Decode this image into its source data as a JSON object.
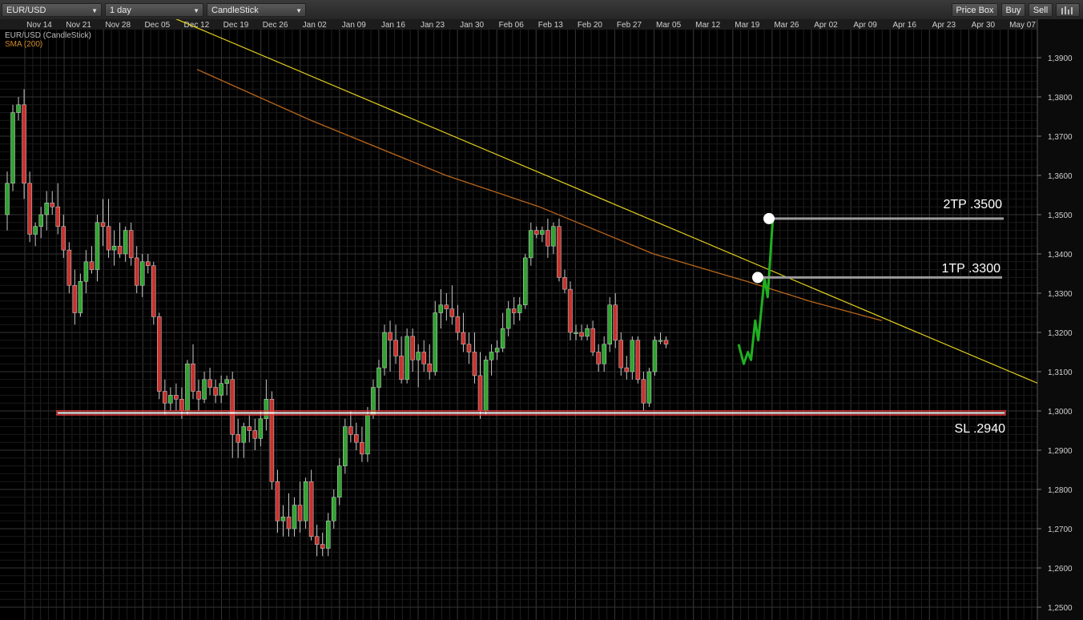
{
  "toolbar": {
    "symbol": "EUR/USD",
    "period": "1 day",
    "chart_type": "CandleStick",
    "price_box": "Price Box",
    "buy": "Buy",
    "sell": "Sell",
    "indicator_icon": "bar-chart-icon"
  },
  "legend": {
    "series1": "EUR/USD (CandleStick)",
    "series2": "SMA (200)"
  },
  "colors": {
    "up": "#2fa52f",
    "down": "#c8322d",
    "trendline": "#e6d21e",
    "sma": "#b8661a",
    "support": "#e23a3a",
    "projection": "#20b020"
  },
  "annotations": {
    "tp2": "2TP .3500",
    "tp1": "1TP .3300",
    "sl": "SL .2940"
  },
  "chart_data": {
    "type": "candlestick",
    "x_ticks": [
      "Nov 14",
      "Nov 21",
      "Nov 28",
      "Dec 05",
      "Dec 12",
      "Dec 19",
      "Dec 26",
      "Jan 02",
      "Jan 09",
      "Jan 16",
      "Jan 23",
      "Jan 30",
      "Feb 06",
      "Feb 13",
      "Feb 20",
      "Feb 27",
      "Mar 05",
      "Mar 12",
      "Mar 19",
      "Mar 26",
      "Apr 02",
      "Apr 09",
      "Apr 16",
      "Apr 23",
      "Apr 30",
      "May 07"
    ],
    "y_ticks": [
      "1,3900",
      "1,3800",
      "1,3700",
      "1,3600",
      "1,3500",
      "1,3400",
      "1,3300",
      "1,3200",
      "1,3100",
      "1,3000",
      "1,2900",
      "1,2800",
      "1,2700",
      "1,2600",
      "1,2500"
    ],
    "ylim": [
      1.247,
      1.4
    ],
    "candles": [
      [
        1.35,
        1.361,
        1.346,
        1.358
      ],
      [
        1.358,
        1.378,
        1.356,
        1.376
      ],
      [
        1.376,
        1.38,
        1.374,
        1.378
      ],
      [
        1.378,
        1.382,
        1.354,
        1.358
      ],
      [
        1.358,
        1.361,
        1.343,
        1.345
      ],
      [
        1.345,
        1.348,
        1.342,
        1.347
      ],
      [
        1.347,
        1.352,
        1.344,
        1.35
      ],
      [
        1.35,
        1.356,
        1.346,
        1.353
      ],
      [
        1.353,
        1.356,
        1.35,
        1.352
      ],
      [
        1.352,
        1.358,
        1.345,
        1.347
      ],
      [
        1.347,
        1.35,
        1.339,
        1.341
      ],
      [
        1.341,
        1.343,
        1.33,
        1.332
      ],
      [
        1.332,
        1.336,
        1.322,
        1.325
      ],
      [
        1.325,
        1.335,
        1.324,
        1.333
      ],
      [
        1.333,
        1.341,
        1.33,
        1.338
      ],
      [
        1.338,
        1.342,
        1.335,
        1.336
      ],
      [
        1.336,
        1.35,
        1.333,
        1.348
      ],
      [
        1.348,
        1.354,
        1.342,
        1.347
      ],
      [
        1.347,
        1.354,
        1.339,
        1.341
      ],
      [
        1.341,
        1.346,
        1.337,
        1.342
      ],
      [
        1.342,
        1.348,
        1.339,
        1.34
      ],
      [
        1.34,
        1.347,
        1.338,
        1.346
      ],
      [
        1.346,
        1.348,
        1.337,
        1.339
      ],
      [
        1.339,
        1.342,
        1.33,
        1.332
      ],
      [
        1.332,
        1.34,
        1.329,
        1.338
      ],
      [
        1.338,
        1.34,
        1.335,
        1.337
      ],
      [
        1.337,
        1.338,
        1.322,
        1.324
      ],
      [
        1.324,
        1.325,
        1.303,
        1.305
      ],
      [
        1.305,
        1.308,
        1.299,
        1.302
      ],
      [
        1.302,
        1.306,
        1.3,
        1.304
      ],
      [
        1.304,
        1.307,
        1.3,
        1.303
      ],
      [
        1.303,
        1.306,
        1.298,
        1.3
      ],
      [
        1.3,
        1.313,
        1.299,
        1.312
      ],
      [
        1.312,
        1.317,
        1.303,
        1.305
      ],
      [
        1.305,
        1.308,
        1.3,
        1.303
      ],
      [
        1.303,
        1.31,
        1.302,
        1.308
      ],
      [
        1.308,
        1.311,
        1.304,
        1.306
      ],
      [
        1.306,
        1.308,
        1.302,
        1.304
      ],
      [
        1.304,
        1.309,
        1.302,
        1.307
      ],
      [
        1.307,
        1.309,
        1.304,
        1.308
      ],
      [
        1.308,
        1.31,
        1.288,
        1.294
      ],
      [
        1.294,
        1.298,
        1.288,
        1.292
      ],
      [
        1.292,
        1.297,
        1.288,
        1.296
      ],
      [
        1.296,
        1.299,
        1.292,
        1.295
      ],
      [
        1.295,
        1.298,
        1.29,
        1.293
      ],
      [
        1.293,
        1.3,
        1.291,
        1.298
      ],
      [
        1.298,
        1.308,
        1.295,
        1.303
      ],
      [
        1.303,
        1.305,
        1.28,
        1.282
      ],
      [
        1.282,
        1.285,
        1.269,
        1.272
      ],
      [
        1.272,
        1.276,
        1.268,
        1.273
      ],
      [
        1.273,
        1.279,
        1.268,
        1.27
      ],
      [
        1.27,
        1.278,
        1.268,
        1.276
      ],
      [
        1.276,
        1.282,
        1.269,
        1.272
      ],
      [
        1.272,
        1.283,
        1.27,
        1.282
      ],
      [
        1.282,
        1.285,
        1.267,
        1.268
      ],
      [
        1.268,
        1.271,
        1.263,
        1.266
      ],
      [
        1.266,
        1.269,
        1.263,
        1.265
      ],
      [
        1.265,
        1.274,
        1.263,
        1.272
      ],
      [
        1.272,
        1.28,
        1.27,
        1.278
      ],
      [
        1.278,
        1.288,
        1.276,
        1.286
      ],
      [
        1.286,
        1.298,
        1.284,
        1.296
      ],
      [
        1.296,
        1.3,
        1.292,
        1.294
      ],
      [
        1.294,
        1.297,
        1.29,
        1.292
      ],
      [
        1.292,
        1.296,
        1.287,
        1.289
      ],
      [
        1.289,
        1.301,
        1.287,
        1.299
      ],
      [
        1.299,
        1.308,
        1.298,
        1.306
      ],
      [
        1.306,
        1.313,
        1.3,
        1.311
      ],
      [
        1.311,
        1.322,
        1.309,
        1.32
      ],
      [
        1.32,
        1.323,
        1.31,
        1.318
      ],
      [
        1.318,
        1.322,
        1.312,
        1.314
      ],
      [
        1.314,
        1.319,
        1.307,
        1.308
      ],
      [
        1.308,
        1.321,
        1.307,
        1.319
      ],
      [
        1.319,
        1.321,
        1.31,
        1.313
      ],
      [
        1.313,
        1.317,
        1.306,
        1.315
      ],
      [
        1.315,
        1.318,
        1.31,
        1.312
      ],
      [
        1.312,
        1.317,
        1.308,
        1.31
      ],
      [
        1.31,
        1.328,
        1.309,
        1.325
      ],
      [
        1.325,
        1.331,
        1.321,
        1.327
      ],
      [
        1.327,
        1.33,
        1.323,
        1.326
      ],
      [
        1.326,
        1.332,
        1.322,
        1.324
      ],
      [
        1.324,
        1.327,
        1.318,
        1.32
      ],
      [
        1.32,
        1.325,
        1.315,
        1.317
      ],
      [
        1.317,
        1.32,
        1.312,
        1.315
      ],
      [
        1.315,
        1.32,
        1.307,
        1.309
      ],
      [
        1.309,
        1.315,
        1.298,
        1.3
      ],
      [
        1.3,
        1.314,
        1.299,
        1.313
      ],
      [
        1.313,
        1.317,
        1.309,
        1.315
      ],
      [
        1.315,
        1.318,
        1.313,
        1.316
      ],
      [
        1.316,
        1.325,
        1.315,
        1.321
      ],
      [
        1.321,
        1.328,
        1.319,
        1.326
      ],
      [
        1.326,
        1.329,
        1.322,
        1.325
      ],
      [
        1.325,
        1.329,
        1.323,
        1.327
      ],
      [
        1.327,
        1.34,
        1.326,
        1.339
      ],
      [
        1.339,
        1.348,
        1.337,
        1.346
      ],
      [
        1.346,
        1.347,
        1.344,
        1.345
      ],
      [
        1.345,
        1.347,
        1.343,
        1.346
      ],
      [
        1.346,
        1.349,
        1.339,
        1.342
      ],
      [
        1.342,
        1.348,
        1.34,
        1.347
      ],
      [
        1.347,
        1.349,
        1.333,
        1.334
      ],
      [
        1.334,
        1.336,
        1.33,
        1.331
      ],
      [
        1.331,
        1.333,
        1.318,
        1.32
      ],
      [
        1.32,
        1.322,
        1.318,
        1.32
      ],
      [
        1.32,
        1.322,
        1.318,
        1.319
      ],
      [
        1.319,
        1.322,
        1.318,
        1.321
      ],
      [
        1.321,
        1.323,
        1.314,
        1.315
      ],
      [
        1.315,
        1.317,
        1.31,
        1.312
      ],
      [
        1.312,
        1.319,
        1.31,
        1.317
      ],
      [
        1.317,
        1.329,
        1.315,
        1.327
      ],
      [
        1.327,
        1.33,
        1.316,
        1.318
      ],
      [
        1.318,
        1.32,
        1.309,
        1.311
      ],
      [
        1.311,
        1.314,
        1.308,
        1.31
      ],
      [
        1.31,
        1.319,
        1.308,
        1.318
      ],
      [
        1.318,
        1.319,
        1.307,
        1.308
      ],
      [
        1.308,
        1.31,
        1.3,
        1.302
      ],
      [
        1.302,
        1.311,
        1.301,
        1.31
      ],
      [
        1.31,
        1.319,
        1.309,
        1.318
      ],
      [
        1.318,
        1.32,
        1.317,
        1.318
      ],
      [
        1.318,
        1.319,
        1.316,
        1.317
      ]
    ],
    "sma200": [
      [
        1.387,
        0.19
      ],
      [
        1.374,
        0.3
      ],
      [
        1.36,
        0.43
      ],
      [
        1.352,
        0.52
      ],
      [
        1.34,
        0.63
      ],
      [
        1.333,
        0.72
      ],
      [
        1.328,
        0.78
      ],
      [
        1.323,
        0.85
      ]
    ],
    "trendline": [
      [
        1.395,
        0.15
      ],
      [
        1.3075,
        1.0
      ]
    ],
    "support": 1.2995,
    "tp1_price": 1.334,
    "tp2_price": 1.349,
    "projection": [
      [
        1.317,
        0.712
      ],
      [
        1.312,
        0.717
      ],
      [
        1.315,
        0.721
      ],
      [
        1.313,
        0.724
      ],
      [
        1.323,
        0.728
      ],
      [
        1.318,
        0.731
      ],
      [
        1.334,
        0.737
      ],
      [
        1.329,
        0.74
      ],
      [
        1.349,
        0.745
      ]
    ]
  }
}
